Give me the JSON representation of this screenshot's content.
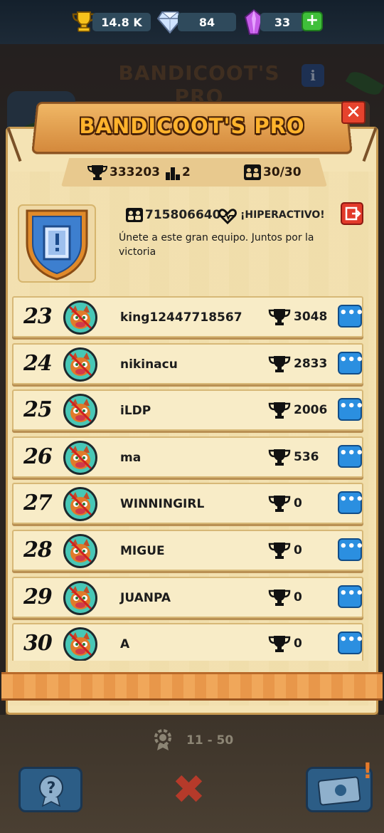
{
  "currencies": {
    "trophies": "14.8 K",
    "gems": "84",
    "crystals": "33"
  },
  "team": {
    "name": "BANDICOOT'S PRO",
    "total_trophies": "333203",
    "rank_value": "2",
    "members": "30/30",
    "tag": "715806640",
    "activity": "¡HIPERACTIVO!",
    "description": "Únete a este gran equipo. Juntos por la victoria"
  },
  "rows": [
    {
      "rank": "23",
      "name": "king12447718567",
      "score": "3048"
    },
    {
      "rank": "24",
      "name": "nikinacu",
      "score": "2833"
    },
    {
      "rank": "25",
      "name": "iLDP",
      "score": "2006"
    },
    {
      "rank": "26",
      "name": "ma",
      "score": "536"
    },
    {
      "rank": "27",
      "name": "WINNINGIRL",
      "score": "0"
    },
    {
      "rank": "28",
      "name": "MIGUE",
      "score": "0"
    },
    {
      "rank": "29",
      "name": "JUANPA",
      "score": "0"
    },
    {
      "rank": "30",
      "name": "A",
      "score": "0"
    }
  ],
  "footer": {
    "page_range": "11 - 50"
  },
  "icons": {
    "trophy": "trophy-icon",
    "gem": "gem-icon",
    "crystal": "crystal-icon",
    "plus": "plus-icon",
    "info": "info-icon",
    "close": "close-icon",
    "members": "members-icon",
    "heart": "heart-icon",
    "leave": "leave-team-icon",
    "more": "more-options-icon",
    "help": "help-icon",
    "ticket": "ticket-icon"
  },
  "colors": {
    "title": "#ffb32c",
    "panel": "#f4e3b4",
    "row": "#f8ecc7",
    "more_button": "#2b8fe0",
    "close_button": "#e6432d"
  }
}
